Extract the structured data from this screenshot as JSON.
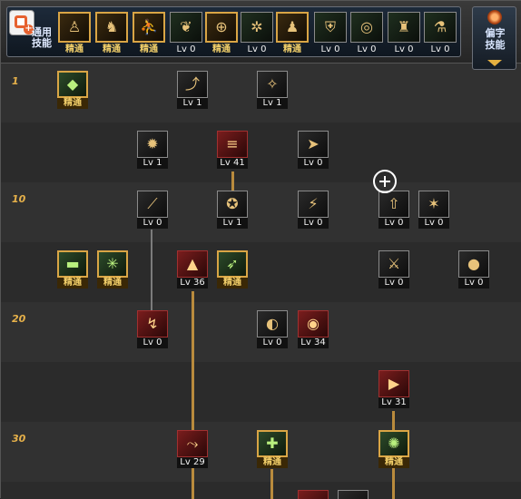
{
  "header": {
    "common_label": "通用\n技能",
    "pref_label": "偏字\n技能",
    "top_skills": [
      {
        "icon": "skill-sit-icon",
        "level": "精通",
        "gold": true
      },
      {
        "icon": "skill-pose-icon",
        "level": "精通",
        "gold": true
      },
      {
        "icon": "skill-run-icon",
        "level": "精通",
        "gold": true
      },
      {
        "icon": "skill-wings-icon",
        "level": "Lv 0",
        "gold": false
      },
      {
        "icon": "skill-target-icon",
        "level": "精通",
        "gold": true
      },
      {
        "icon": "skill-gear-icon",
        "level": "Lv 0",
        "gold": false
      },
      {
        "icon": "skill-figure-icon",
        "level": "精通",
        "gold": true
      },
      {
        "icon": "skill-shield-icon",
        "level": "Lv 0",
        "gold": false
      },
      {
        "icon": "skill-spiral-icon",
        "level": "Lv 0",
        "gold": false
      },
      {
        "icon": "skill-flex-icon",
        "level": "Lv 0",
        "gold": false
      },
      {
        "icon": "skill-bottle-icon",
        "level": "Lv 0",
        "gold": false
      }
    ]
  },
  "rows": [
    {
      "label": "1"
    },
    {
      "label": ""
    },
    {
      "label": "10"
    },
    {
      "label": ""
    },
    {
      "label": "20"
    },
    {
      "label": ""
    },
    {
      "label": "30"
    }
  ],
  "skills": [
    {
      "name": "skill-r1-a",
      "level": "精通",
      "style": "gold",
      "glyph": "◆"
    },
    {
      "name": "skill-r1-b",
      "level": "Lv 1",
      "style": "plain",
      "glyph": "⤴"
    },
    {
      "name": "skill-r1-c",
      "level": "Lv 1",
      "style": "plain",
      "glyph": "✧"
    },
    {
      "name": "skill-r2-a",
      "level": "Lv 1",
      "style": "plain",
      "glyph": "✹"
    },
    {
      "name": "skill-r2-b",
      "level": "Lv 41",
      "style": "red",
      "glyph": "≡"
    },
    {
      "name": "skill-r2-c",
      "level": "Lv 0",
      "style": "plain",
      "glyph": "➤"
    },
    {
      "name": "skill-r3-a",
      "level": "Lv 0",
      "style": "plain",
      "glyph": "⟋"
    },
    {
      "name": "skill-r3-b",
      "level": "Lv 1",
      "style": "plain",
      "glyph": "✪"
    },
    {
      "name": "skill-r3-c",
      "level": "Lv 0",
      "style": "plain",
      "glyph": "⚡"
    },
    {
      "name": "skill-r3-d",
      "level": "Lv 0",
      "style": "plain",
      "glyph": "⇧"
    },
    {
      "name": "skill-r3-e",
      "level": "Lv 0",
      "style": "plain",
      "glyph": "✶"
    },
    {
      "name": "skill-r4-a",
      "level": "精通",
      "style": "gold",
      "glyph": "▬"
    },
    {
      "name": "skill-r4-b",
      "level": "精通",
      "style": "gold",
      "glyph": "✳"
    },
    {
      "name": "skill-r4-c",
      "level": "Lv 36",
      "style": "red",
      "glyph": "▲"
    },
    {
      "name": "skill-r4-d",
      "level": "精通",
      "style": "gold",
      "glyph": "➶"
    },
    {
      "name": "skill-r4-e",
      "level": "Lv 0",
      "style": "plain",
      "glyph": "⚔"
    },
    {
      "name": "skill-r4-f",
      "level": "Lv 0",
      "style": "plain",
      "glyph": "●"
    },
    {
      "name": "skill-r5-a",
      "level": "Lv 0",
      "style": "red",
      "glyph": "↯"
    },
    {
      "name": "skill-r5-b",
      "level": "Lv 0",
      "style": "plain",
      "glyph": "◐"
    },
    {
      "name": "skill-r5-c",
      "level": "Lv 34",
      "style": "red",
      "glyph": "◉"
    },
    {
      "name": "skill-r6-a",
      "level": "Lv 31",
      "style": "red",
      "glyph": "▶"
    },
    {
      "name": "skill-r7-a",
      "level": "Lv 29",
      "style": "red",
      "glyph": "⤳"
    },
    {
      "name": "skill-r7-b",
      "level": "精通",
      "style": "gold",
      "glyph": "✚"
    },
    {
      "name": "skill-r7-c",
      "level": "精通",
      "style": "gold",
      "glyph": "✺"
    }
  ]
}
